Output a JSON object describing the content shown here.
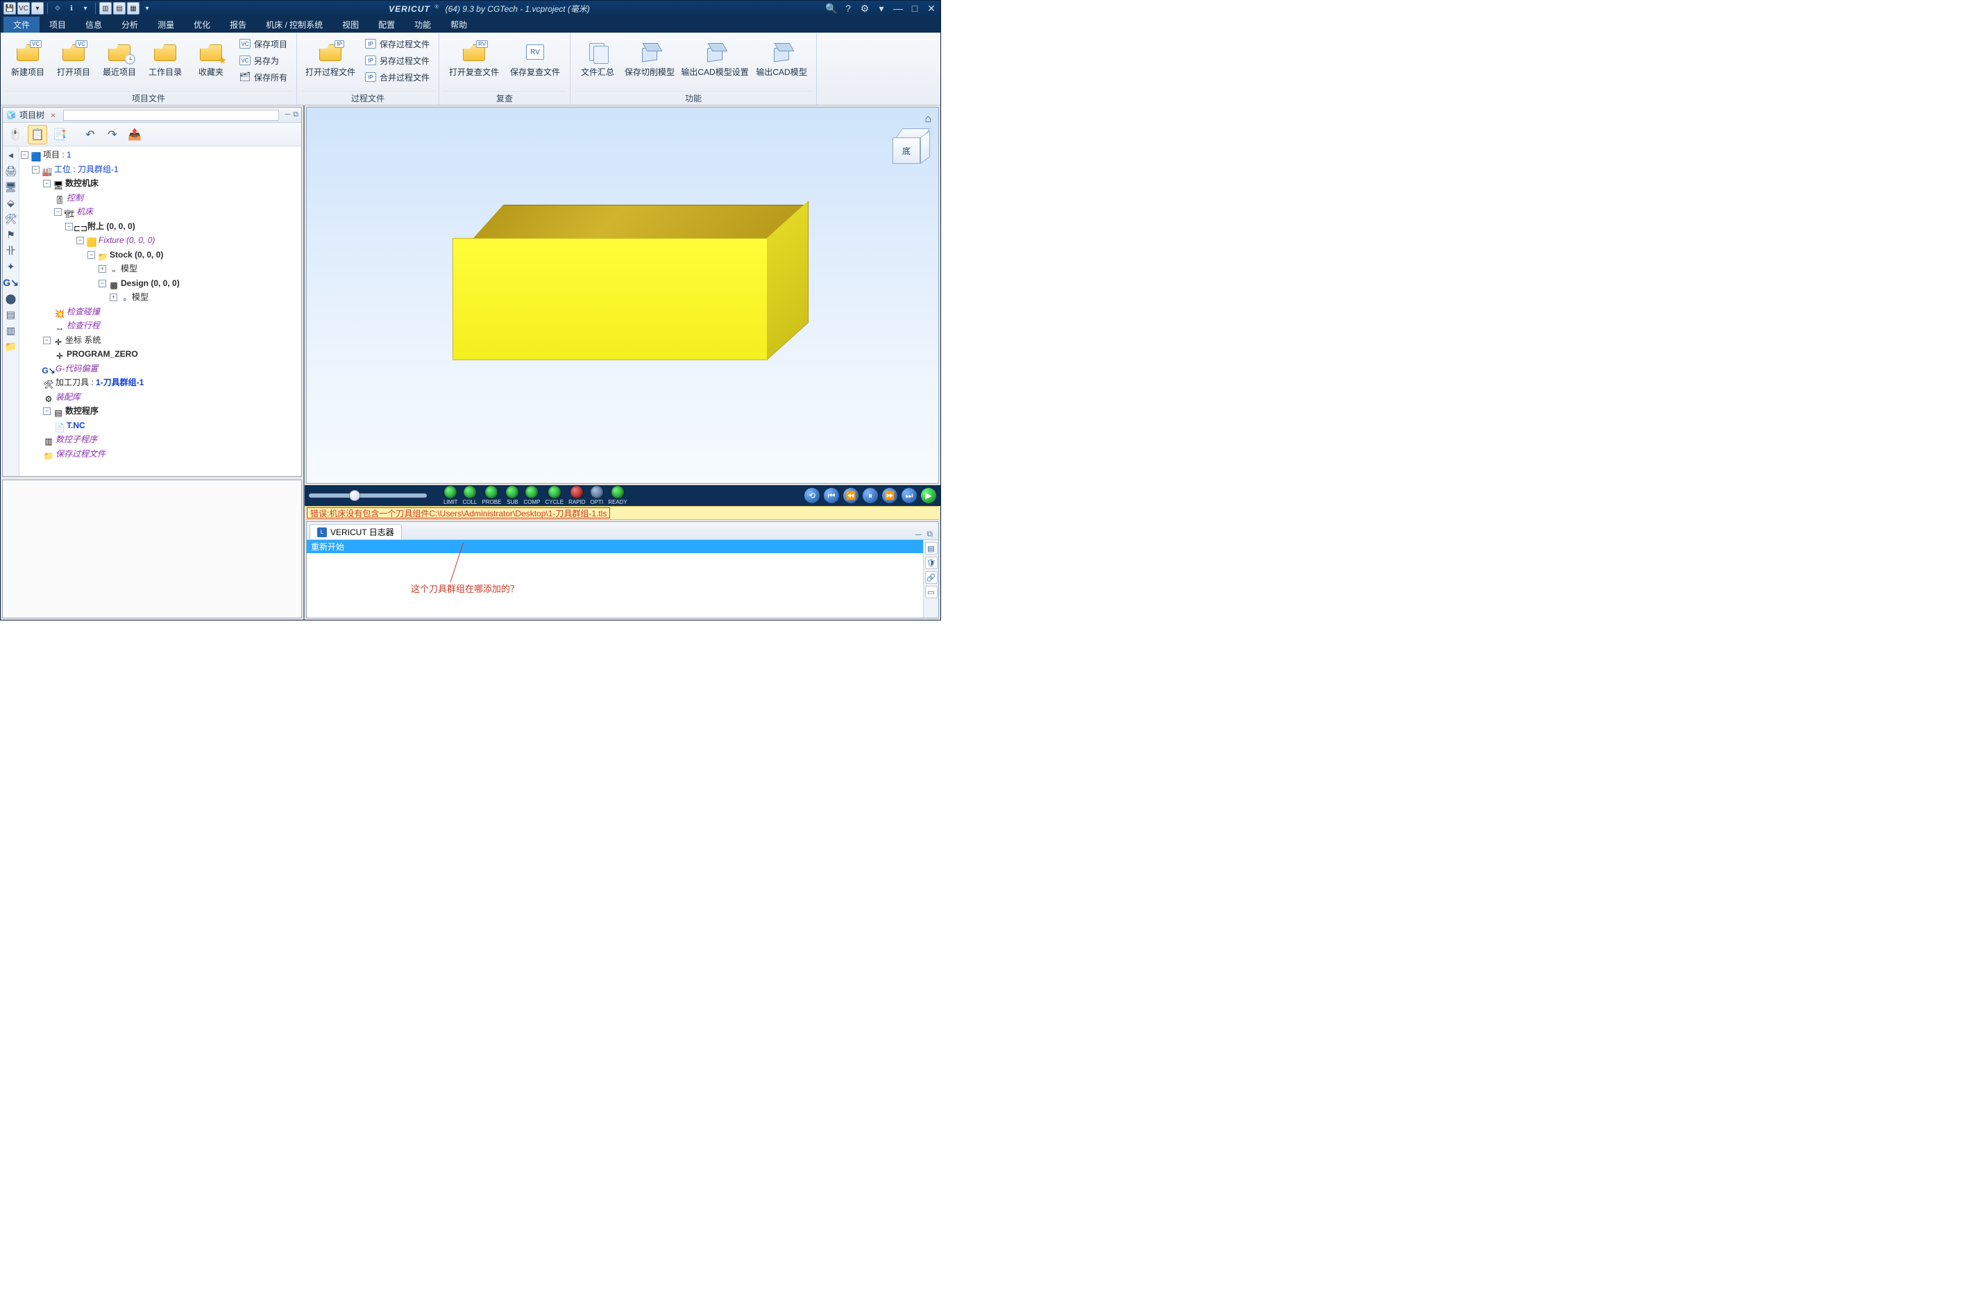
{
  "title": {
    "brand": "VERICUT",
    "suffix": "(64)  9.3 by CGTech - 1.vcproject (毫米)"
  },
  "menu": {
    "items": [
      "文件",
      "项目",
      "信息",
      "分析",
      "测量",
      "优化",
      "报告",
      "机床 / 控制系统",
      "视图",
      "配置",
      "功能",
      "帮助"
    ],
    "active": 0
  },
  "ribbon": {
    "g1": {
      "cap": "项目文件",
      "big": [
        {
          "l": "新建项目",
          "k": "new"
        },
        {
          "l": "打开项目",
          "k": "open"
        },
        {
          "l": "最近项目",
          "k": "recent"
        },
        {
          "l": "工作目录",
          "k": "workdir"
        },
        {
          "l": "收藏夹",
          "k": "fav"
        }
      ],
      "small": [
        {
          "l": "保存项目"
        },
        {
          "l": "另存为"
        },
        {
          "l": "保存所有"
        }
      ]
    },
    "g2": {
      "cap": "过程文件",
      "big": [
        {
          "l": "打开过程文件",
          "k": "open-ip"
        }
      ],
      "small": [
        {
          "l": "保存过程文件"
        },
        {
          "l": "另存过程文件"
        },
        {
          "l": "合并过程文件"
        }
      ]
    },
    "g3": {
      "cap": "复查",
      "big": [
        {
          "l": "打开复查文件",
          "k": "open-rv"
        },
        {
          "l": "保存复查文件",
          "k": "save-rv"
        }
      ]
    },
    "g4": {
      "cap": "功能",
      "big": [
        {
          "l": "文件汇总",
          "k": "summary"
        },
        {
          "l": "保存切削模型",
          "k": "save-cut"
        },
        {
          "l": "输出CAD模型设置",
          "k": "cad-set"
        },
        {
          "l": "输出CAD模型",
          "k": "cad-out"
        }
      ]
    }
  },
  "panel": {
    "title": "项目树"
  },
  "navcube": {
    "face": "底"
  },
  "tree": {
    "root": {
      "l": "项目 :",
      "v": "1"
    },
    "setup": {
      "l": "工位 : 刀具群组",
      "v": "-1"
    },
    "cnc": "数控机床",
    "ctrl": "控制",
    "mach": "机床",
    "attach": "附上 (0, 0, 0)",
    "fixture": "Fixture (0, 0, 0)",
    "stock": "Stock (0, 0, 0)",
    "model1": "模型",
    "design": "Design (0, 0, 0)",
    "model2": "模型",
    "chkcol": "检查碰撞",
    "chktrv": "检查行程",
    "csys": "坐标 系统",
    "pz": "PROGRAM_ZERO",
    "goff": "G-代码偏置",
    "tool": {
      "l": "加工刀具 :",
      "v": "1-刀具群组-1"
    },
    "assy": "装配库",
    "nc": "数控程序",
    "tnc": "T.NC",
    "sub": "数控子程序",
    "saveip": "保存过程文件"
  },
  "leds": [
    {
      "n": "LIMIT",
      "c": "green"
    },
    {
      "n": "COLL",
      "c": "green"
    },
    {
      "n": "PROBE",
      "c": "green"
    },
    {
      "n": "SUB",
      "c": "green"
    },
    {
      "n": "COMP",
      "c": "green"
    },
    {
      "n": "CYCLE",
      "c": "green"
    },
    {
      "n": "RAPID",
      "c": "red"
    },
    {
      "n": "OPTI",
      "c": "off"
    },
    {
      "n": "READY",
      "c": "green"
    }
  ],
  "error": {
    "pre": "错误:机床没有包含一个刀具组件 ",
    "path": "C:\\Users\\Administrator\\Desktop\\1-刀具群组-1.tls"
  },
  "log": {
    "tab": "VERICUT 日志器",
    "line": "重新开始"
  },
  "annotation": "这个刀具群组在哪添加的？"
}
